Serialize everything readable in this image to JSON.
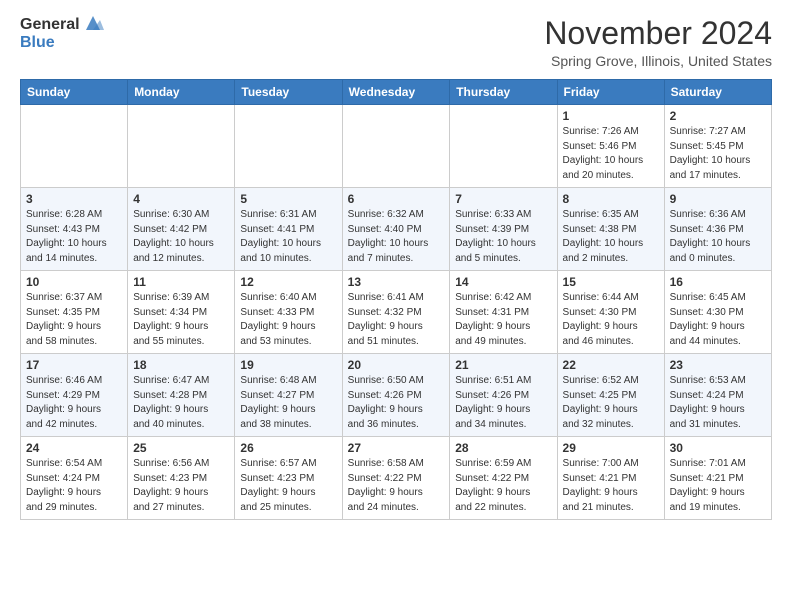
{
  "app": {
    "logo_general": "General",
    "logo_blue": "Blue"
  },
  "header": {
    "month": "November 2024",
    "location": "Spring Grove, Illinois, United States"
  },
  "weekdays": [
    "Sunday",
    "Monday",
    "Tuesday",
    "Wednesday",
    "Thursday",
    "Friday",
    "Saturday"
  ],
  "weeks": [
    [
      {
        "day": "",
        "info": ""
      },
      {
        "day": "",
        "info": ""
      },
      {
        "day": "",
        "info": ""
      },
      {
        "day": "",
        "info": ""
      },
      {
        "day": "",
        "info": ""
      },
      {
        "day": "1",
        "info": "Sunrise: 7:26 AM\nSunset: 5:46 PM\nDaylight: 10 hours\nand 20 minutes."
      },
      {
        "day": "2",
        "info": "Sunrise: 7:27 AM\nSunset: 5:45 PM\nDaylight: 10 hours\nand 17 minutes."
      }
    ],
    [
      {
        "day": "3",
        "info": "Sunrise: 6:28 AM\nSunset: 4:43 PM\nDaylight: 10 hours\nand 14 minutes."
      },
      {
        "day": "4",
        "info": "Sunrise: 6:30 AM\nSunset: 4:42 PM\nDaylight: 10 hours\nand 12 minutes."
      },
      {
        "day": "5",
        "info": "Sunrise: 6:31 AM\nSunset: 4:41 PM\nDaylight: 10 hours\nand 10 minutes."
      },
      {
        "day": "6",
        "info": "Sunrise: 6:32 AM\nSunset: 4:40 PM\nDaylight: 10 hours\nand 7 minutes."
      },
      {
        "day": "7",
        "info": "Sunrise: 6:33 AM\nSunset: 4:39 PM\nDaylight: 10 hours\nand 5 minutes."
      },
      {
        "day": "8",
        "info": "Sunrise: 6:35 AM\nSunset: 4:38 PM\nDaylight: 10 hours\nand 2 minutes."
      },
      {
        "day": "9",
        "info": "Sunrise: 6:36 AM\nSunset: 4:36 PM\nDaylight: 10 hours\nand 0 minutes."
      }
    ],
    [
      {
        "day": "10",
        "info": "Sunrise: 6:37 AM\nSunset: 4:35 PM\nDaylight: 9 hours\nand 58 minutes."
      },
      {
        "day": "11",
        "info": "Sunrise: 6:39 AM\nSunset: 4:34 PM\nDaylight: 9 hours\nand 55 minutes."
      },
      {
        "day": "12",
        "info": "Sunrise: 6:40 AM\nSunset: 4:33 PM\nDaylight: 9 hours\nand 53 minutes."
      },
      {
        "day": "13",
        "info": "Sunrise: 6:41 AM\nSunset: 4:32 PM\nDaylight: 9 hours\nand 51 minutes."
      },
      {
        "day": "14",
        "info": "Sunrise: 6:42 AM\nSunset: 4:31 PM\nDaylight: 9 hours\nand 49 minutes."
      },
      {
        "day": "15",
        "info": "Sunrise: 6:44 AM\nSunset: 4:30 PM\nDaylight: 9 hours\nand 46 minutes."
      },
      {
        "day": "16",
        "info": "Sunrise: 6:45 AM\nSunset: 4:30 PM\nDaylight: 9 hours\nand 44 minutes."
      }
    ],
    [
      {
        "day": "17",
        "info": "Sunrise: 6:46 AM\nSunset: 4:29 PM\nDaylight: 9 hours\nand 42 minutes."
      },
      {
        "day": "18",
        "info": "Sunrise: 6:47 AM\nSunset: 4:28 PM\nDaylight: 9 hours\nand 40 minutes."
      },
      {
        "day": "19",
        "info": "Sunrise: 6:48 AM\nSunset: 4:27 PM\nDaylight: 9 hours\nand 38 minutes."
      },
      {
        "day": "20",
        "info": "Sunrise: 6:50 AM\nSunset: 4:26 PM\nDaylight: 9 hours\nand 36 minutes."
      },
      {
        "day": "21",
        "info": "Sunrise: 6:51 AM\nSunset: 4:26 PM\nDaylight: 9 hours\nand 34 minutes."
      },
      {
        "day": "22",
        "info": "Sunrise: 6:52 AM\nSunset: 4:25 PM\nDaylight: 9 hours\nand 32 minutes."
      },
      {
        "day": "23",
        "info": "Sunrise: 6:53 AM\nSunset: 4:24 PM\nDaylight: 9 hours\nand 31 minutes."
      }
    ],
    [
      {
        "day": "24",
        "info": "Sunrise: 6:54 AM\nSunset: 4:24 PM\nDaylight: 9 hours\nand 29 minutes."
      },
      {
        "day": "25",
        "info": "Sunrise: 6:56 AM\nSunset: 4:23 PM\nDaylight: 9 hours\nand 27 minutes."
      },
      {
        "day": "26",
        "info": "Sunrise: 6:57 AM\nSunset: 4:23 PM\nDaylight: 9 hours\nand 25 minutes."
      },
      {
        "day": "27",
        "info": "Sunrise: 6:58 AM\nSunset: 4:22 PM\nDaylight: 9 hours\nand 24 minutes."
      },
      {
        "day": "28",
        "info": "Sunrise: 6:59 AM\nSunset: 4:22 PM\nDaylight: 9 hours\nand 22 minutes."
      },
      {
        "day": "29",
        "info": "Sunrise: 7:00 AM\nSunset: 4:21 PM\nDaylight: 9 hours\nand 21 minutes."
      },
      {
        "day": "30",
        "info": "Sunrise: 7:01 AM\nSunset: 4:21 PM\nDaylight: 9 hours\nand 19 minutes."
      }
    ]
  ]
}
